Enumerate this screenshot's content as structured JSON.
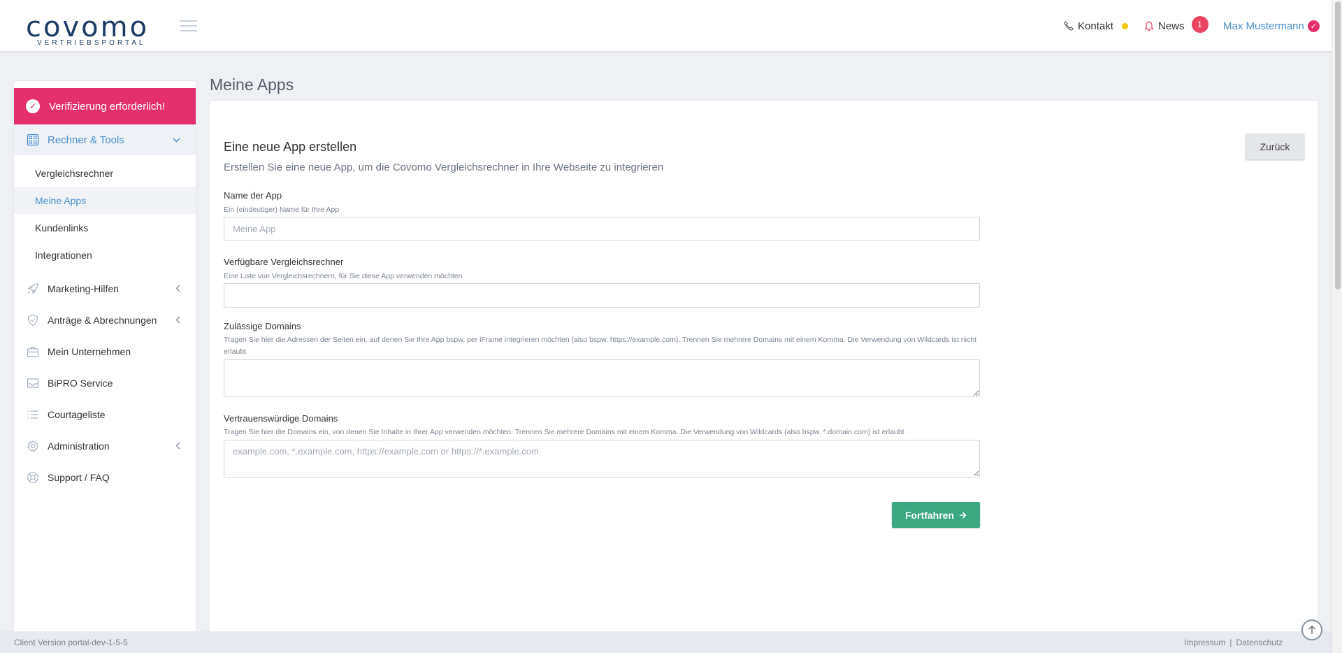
{
  "header": {
    "logo_text": "covomo",
    "logo_subtitle": "VERTRIEBSPORTAL",
    "kontakt_label": "Kontakt",
    "news_label": "News",
    "news_count": "1",
    "user_name": "Max Mustermann"
  },
  "sidebar": {
    "verify_label": "Verifizierung erforderlich!",
    "group_active": "Rechner & Tools",
    "sub_items": [
      {
        "label": "Vergleichsrechner"
      },
      {
        "label": "Meine Apps"
      },
      {
        "label": "Kundenlinks"
      },
      {
        "label": "Integrationen"
      }
    ],
    "items": [
      {
        "label": "Marketing-Hilfen",
        "icon": "rocket-icon"
      },
      {
        "label": "Anträge & Abrechnungen",
        "icon": "shield-icon"
      },
      {
        "label": "Mein Unternehmen",
        "icon": "briefcase-icon"
      },
      {
        "label": "BiPRO Service",
        "icon": "inbox-icon"
      },
      {
        "label": "Courtageliste",
        "icon": "list-icon"
      },
      {
        "label": "Administration",
        "icon": "gear-icon"
      },
      {
        "label": "Support / FAQ",
        "icon": "lifebuoy-icon"
      }
    ]
  },
  "page": {
    "title": "Meine Apps",
    "back_label": "Zurück",
    "form_title": "Eine neue App erstellen",
    "form_subtitle": "Erstellen Sie eine neue App, um die Covomo Vergleichsrechner in Ihre Webseite zu integrieren",
    "fields": {
      "name": {
        "label": "Name der App",
        "help": "Ein (eindeutiger) Name für Ihre App",
        "placeholder": "Meine App"
      },
      "calculators": {
        "label": "Verfügbare Vergleichsrechner",
        "help": "Eine Liste von Vergleichsrechnern, für Sie diese App verwenden möchten"
      },
      "allowed_domains": {
        "label": "Zulässige Domains",
        "help": "Tragen Sie hier die Adressen der Seiten ein, auf denen Sie Ihre App bspw. per iFrame integrieren möchten (also bspw. https://example.com). Trennen Sie mehrere Domains mit einem Komma. Die Verwendung von Wildcards ist nicht erlaubt"
      },
      "trusted_domains": {
        "label": "Vertrauenswürdige Domains",
        "help": "Tragen Sie hier die Domains ein, von denen Sie Inhalte in Ihrer App verwenden möchten. Trennen Sie mehrere Domains mit einem Komma. Die Verwendung von Wildcards (also bspw. *.domain.com) ist erlaubt",
        "placeholder": "example.com, *.example.com, https://example.com or https://*.example.com"
      }
    },
    "submit_label": "Fortfahren"
  },
  "footer": {
    "version": "Client Version portal-dev-1-5-5",
    "impressum": "Impressum",
    "separator": "|",
    "datenschutz": "Datenschutz"
  },
  "colors": {
    "brand": "#1b3a66",
    "accent": "#4a8fcf",
    "verify": "#e6306e",
    "submit": "#3ba882",
    "news_badge": "#e94560",
    "kontakt_status": "#f5c400"
  }
}
